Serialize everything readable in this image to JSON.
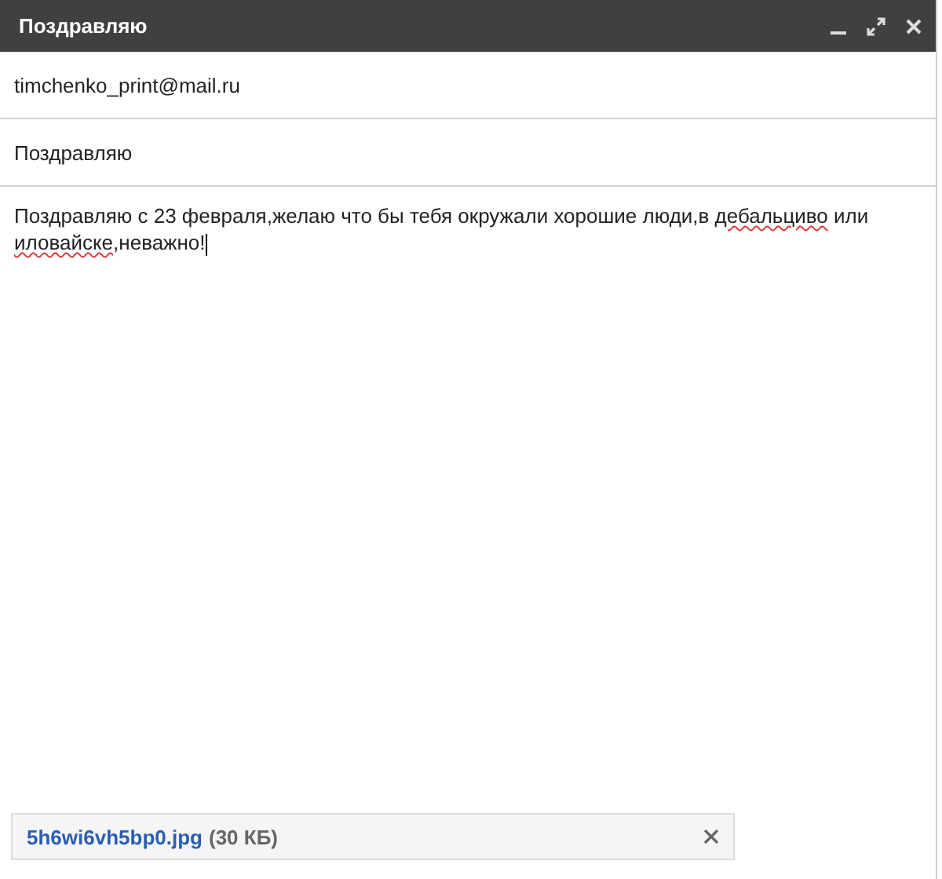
{
  "window": {
    "title": "Поздравляю"
  },
  "to": {
    "value": "timchenko_print@mail.ru"
  },
  "subject": {
    "value": "Поздравляю"
  },
  "body": [
    {
      "text": "Поздравляю с 23 февраля,желаю что бы тебя окружали хорошие люди,в ",
      "misspelled": false
    },
    {
      "text": "дебальциво",
      "misspelled": true
    },
    {
      "text": " или ",
      "misspelled": false
    },
    {
      "text": "иловайске",
      "misspelled": true
    },
    {
      "text": ",неважно!",
      "misspelled": false
    }
  ],
  "attachment": {
    "name": "5h6wi6vh5bp0.jpg",
    "size": "(30 КБ)"
  }
}
